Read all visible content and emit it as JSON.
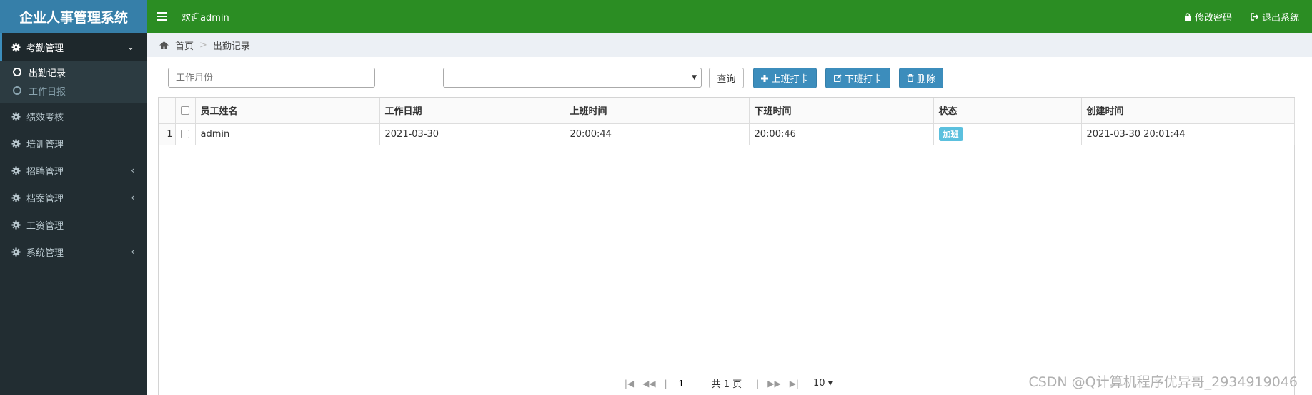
{
  "app": {
    "title": "企业人事管理系统"
  },
  "topbar": {
    "welcome": "欢迎admin",
    "change_password": "修改密码",
    "logout": "退出系统"
  },
  "sidebar": {
    "menus": [
      {
        "label": "考勤管理",
        "expanded": true,
        "chevron": "chevron-down-icon"
      },
      {
        "label": "绩效考核"
      },
      {
        "label": "培训管理"
      },
      {
        "label": "招聘管理",
        "chevron": "chevron-left-icon"
      },
      {
        "label": "档案管理",
        "chevron": "chevron-left-icon"
      },
      {
        "label": "工资管理"
      },
      {
        "label": "系统管理",
        "chevron": "chevron-left-icon"
      }
    ],
    "submenu": [
      {
        "label": "出勤记录",
        "active": true
      },
      {
        "label": "工作日报"
      }
    ]
  },
  "breadcrumb": {
    "home": "首页",
    "current": "出勤记录"
  },
  "toolbar": {
    "month_placeholder": "工作月份",
    "select_value": "",
    "query_label": "查询",
    "clock_in_label": "上班打卡",
    "clock_out_label": "下班打卡",
    "delete_label": "删除"
  },
  "table": {
    "columns": [
      "员工姓名",
      "工作日期",
      "上班时间",
      "下班时间",
      "状态",
      "创建时间"
    ],
    "rows": [
      {
        "num": "1",
        "name": "admin",
        "date": "2021-03-30",
        "in": "20:00:44",
        "out": "20:00:46",
        "status": "加班",
        "created": "2021-03-30 20:01:44"
      }
    ]
  },
  "pager": {
    "page": "1",
    "total_pages": "共 1 页",
    "page_size": "10 ▾"
  },
  "watermark": "CSDN @Q计算机程序优异哥_2934919046",
  "colors": {
    "topbar": "#2b8d23",
    "logo": "#367fa9",
    "sidebar": "#222d32",
    "primary": "#3c8dbc",
    "badge": "#5bc0de"
  }
}
